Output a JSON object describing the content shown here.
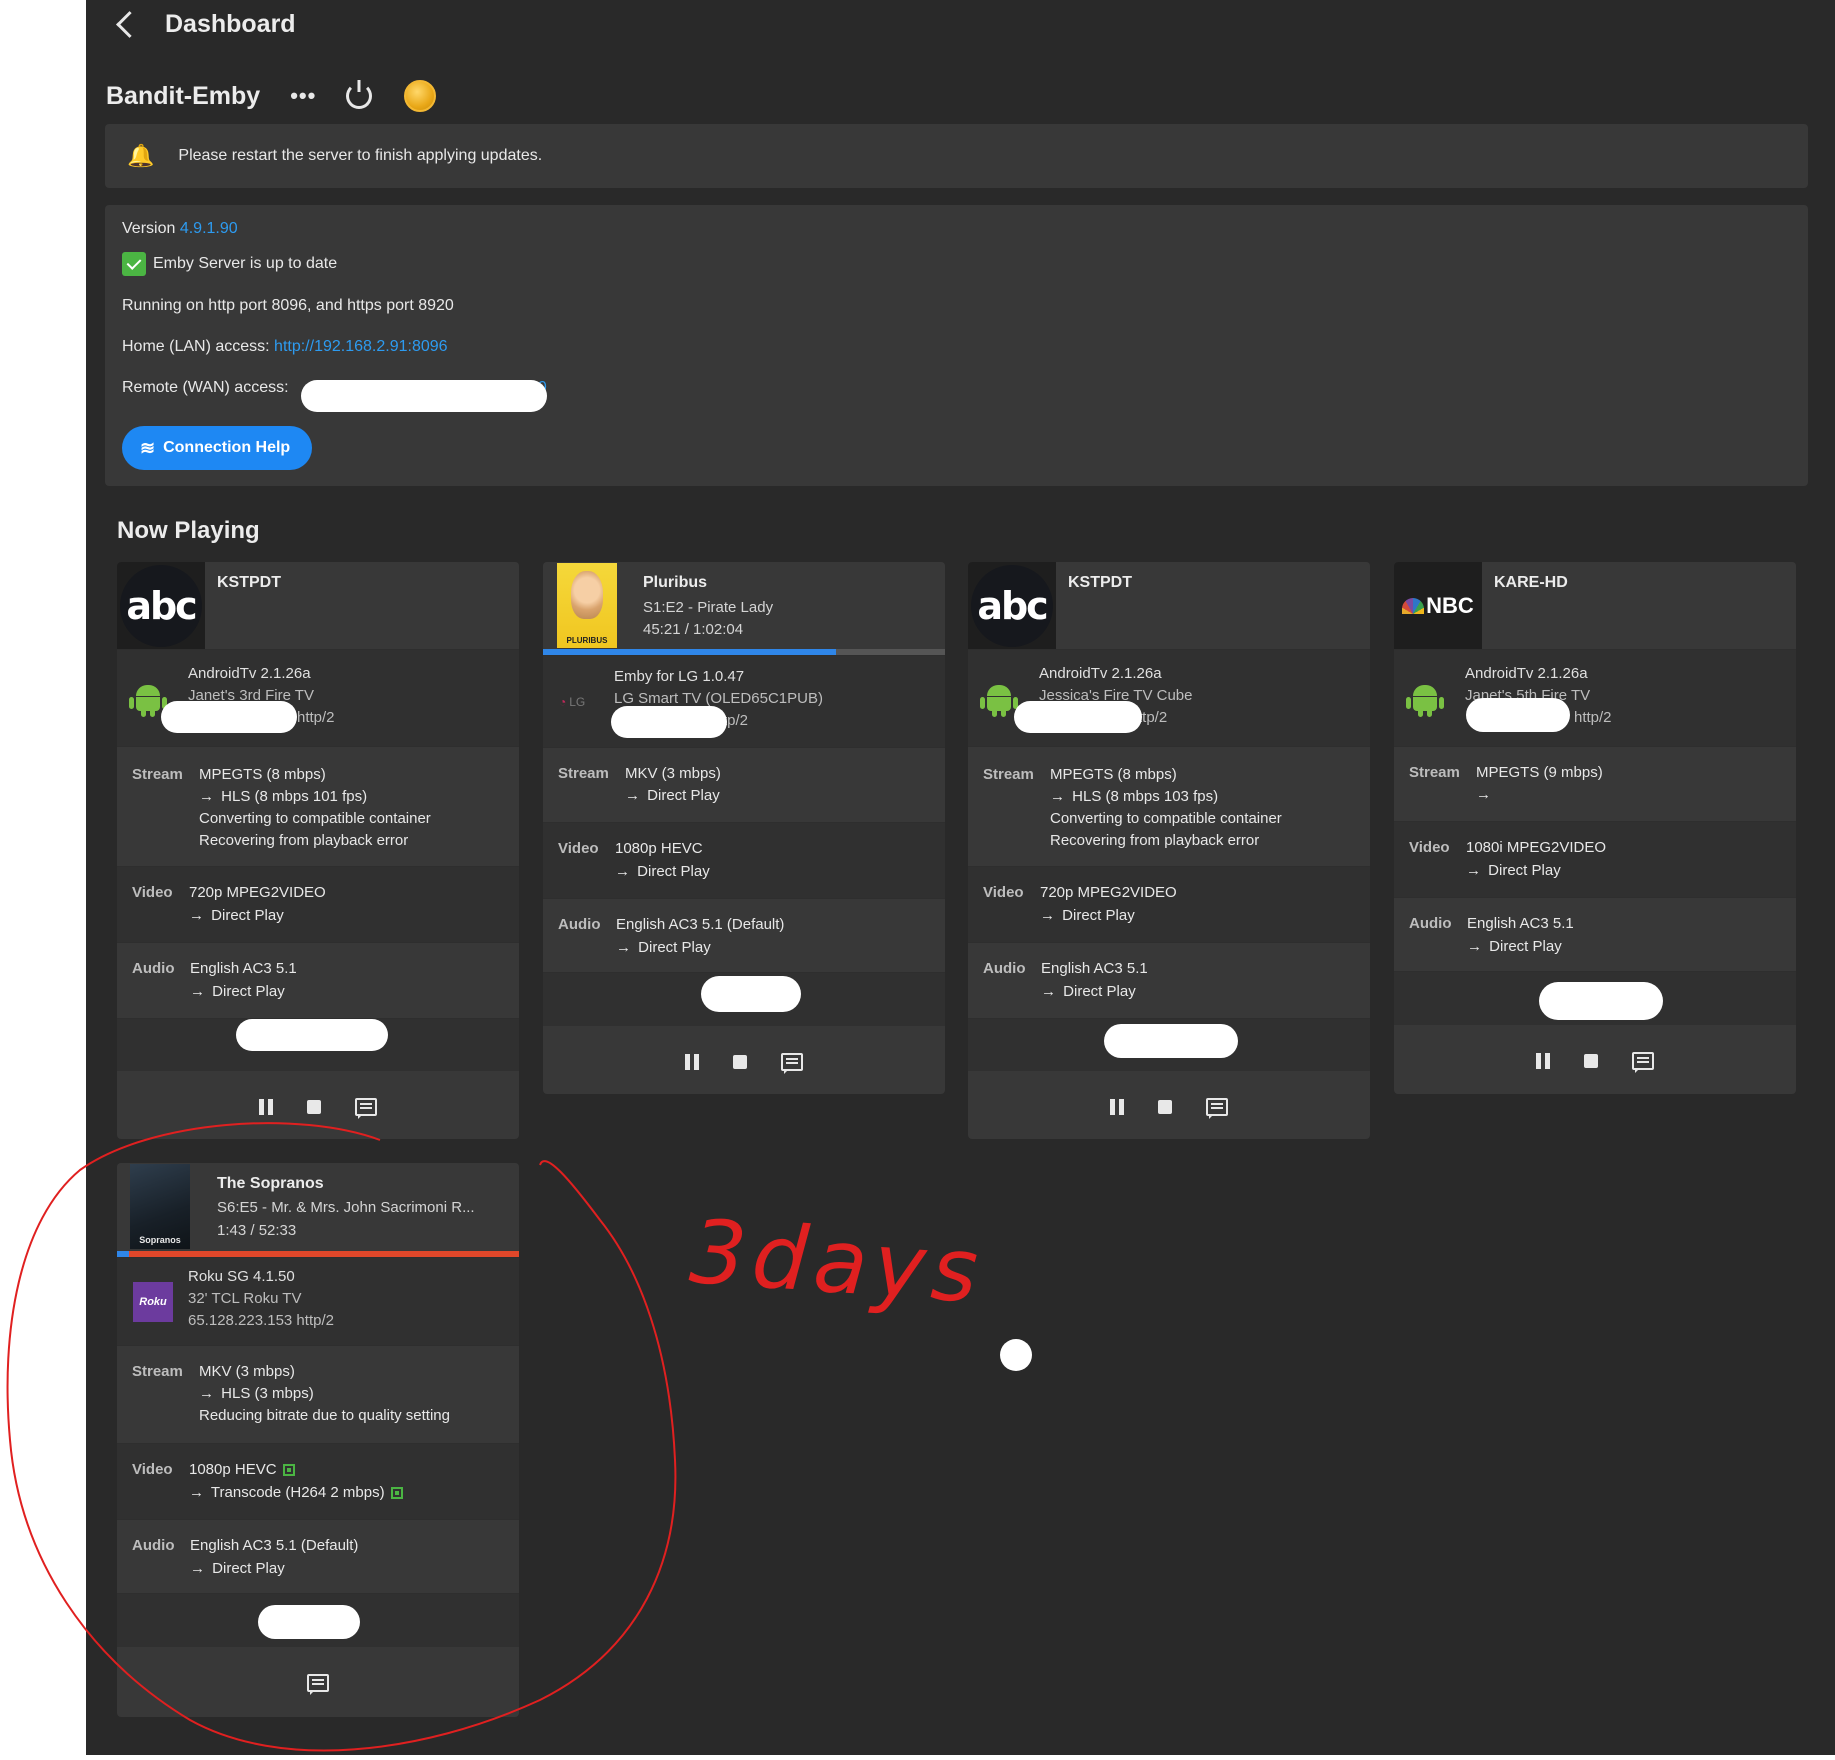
{
  "topbar": {
    "title": "Dashboard"
  },
  "server": {
    "name": "Bandit-Emby",
    "more_label": "•••"
  },
  "alert": {
    "text": "Please restart the server to finish applying updates."
  },
  "info": {
    "version_label": "Version",
    "version": "4.9.1.90",
    "uptodate": "Emby Server is up to date",
    "ports": "Running on http port 8096, and https port 8920",
    "lan_label": "Home (LAN) access:",
    "lan_url": "http://192.168.2.91:8096",
    "wan_label": "Remote (WAN) access:",
    "wan_visible_tail": "20",
    "connection_help": "Connection Help"
  },
  "now_playing": {
    "title": "Now Playing",
    "arrow": "→",
    "stream_label": "Stream",
    "video_label": "Video",
    "audio_label": "Audio",
    "cards": [
      {
        "title": "KSTPDT",
        "logo": "abc",
        "device_app": "AndroidTv 2.1.26a",
        "device_name": "Janet's 3rd Fire TV",
        "device_addr_tail": "http/2",
        "stream": "MPEGTS (8 mbps)",
        "stream_to": "HLS (8 mbps 101 fps)",
        "stream_note1": "Converting to compatible container",
        "stream_note2": "Recovering from playback error",
        "video": "720p MPEG2VIDEO",
        "video_to": "Direct Play",
        "audio": "English AC3 5.1",
        "audio_to": "Direct Play"
      },
      {
        "title": "Pluribus",
        "episode": "S1:E2 - Pirate Lady",
        "time": "45:21 / 1:02:04",
        "poster_text": "PLURIBUS",
        "progress": 0.73,
        "device_app": "Emby for LG 1.0.47",
        "device_name": "LG Smart TV (OLED65C1PUB)",
        "device_addr_tail": "tp/2",
        "device_logo": "LG",
        "stream": "MKV (3 mbps)",
        "stream_to": "Direct Play",
        "video": "1080p HEVC",
        "video_to": "Direct Play",
        "audio": "English AC3 5.1 (Default)",
        "audio_to": "Direct Play"
      },
      {
        "title": "KSTPDT",
        "logo": "abc",
        "device_app": "AndroidTv 2.1.26a",
        "device_name": "Jessica's Fire TV Cube",
        "device_addr_tail": "ttp/2",
        "stream": "MPEGTS (8 mbps)",
        "stream_to": "HLS (8 mbps 103 fps)",
        "stream_note1": "Converting to compatible container",
        "stream_note2": "Recovering from playback error",
        "video": "720p MPEG2VIDEO",
        "video_to": "Direct Play",
        "audio": "English AC3 5.1",
        "audio_to": "Direct Play"
      },
      {
        "title": "KARE-HD",
        "logo": "NBC",
        "device_app": "AndroidTv 2.1.26a",
        "device_name": "Janet's 5th Fire TV",
        "device_addr_tail": "http/2",
        "stream": "MPEGTS (9 mbps)",
        "video": "1080i MPEG2VIDEO",
        "video_to": "Direct Play",
        "audio": "English AC3 5.1",
        "audio_to": "Direct Play"
      },
      {
        "title": "The Sopranos",
        "episode": "S6:E5 - Mr. & Mrs. John Sacrimoni R...",
        "time": "1:43 / 52:33",
        "poster_text": "Sopranos",
        "progress": 0.03,
        "device_app": "Roku SG 4.1.50",
        "device_name": "32' TCL Roku TV",
        "device_addr": "65.128.223.153 http/2",
        "device_logo": "Roku",
        "stream": "MKV (3 mbps)",
        "stream_to": "HLS (3 mbps)",
        "stream_note1": "Reducing bitrate due to quality setting",
        "video": "1080p HEVC",
        "video_to": "Transcode (H264 2 mbps)",
        "audio": "English AC3 5.1 (Default)",
        "audio_to": "Direct Play"
      }
    ]
  },
  "annotation": {
    "text": "3days"
  },
  "colors": {
    "accent": "#2d9bf0",
    "background": "#292929",
    "card": "#383838",
    "annotation": "#e02020"
  }
}
